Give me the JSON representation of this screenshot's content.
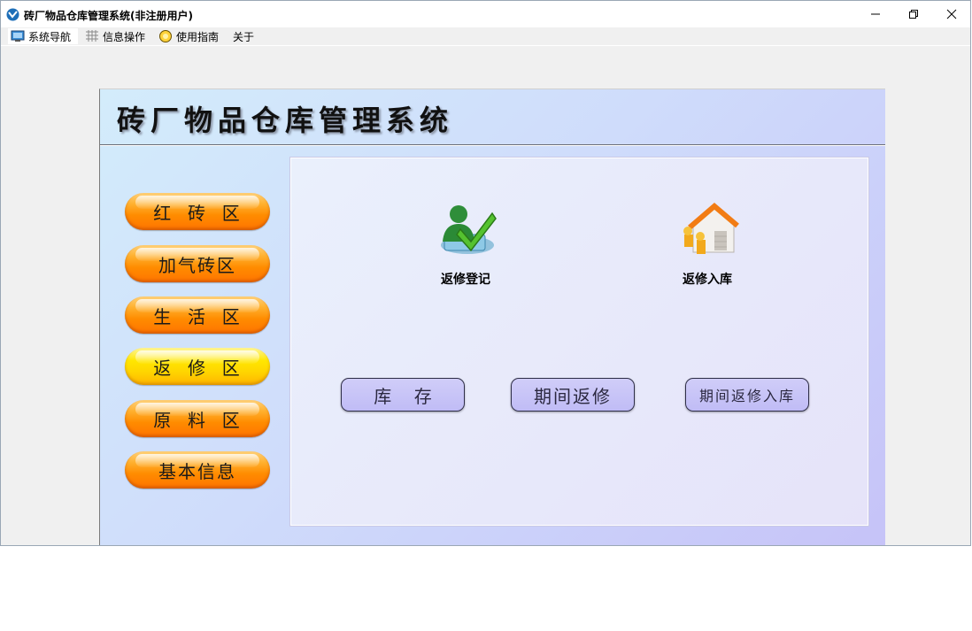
{
  "window": {
    "title": "砖厂物品仓库管理系统(非注册用户)"
  },
  "menu": [
    {
      "label": "系统导航",
      "icon": "monitor-icon",
      "active": true
    },
    {
      "label": "信息操作",
      "icon": "grid-icon",
      "active": false
    },
    {
      "label": "使用指南",
      "icon": "help-icon",
      "active": false
    },
    {
      "label": "关于",
      "icon": "",
      "active": false
    }
  ],
  "header": {
    "title": "砖厂物品仓库管理系统"
  },
  "nav": [
    {
      "label": "红  砖  区",
      "color": "#ff8c00"
    },
    {
      "label": "加气砖区",
      "color": "#ff8c00"
    },
    {
      "label": "生  活  区",
      "color": "#ff8c00"
    },
    {
      "label": "返  修  区",
      "color": "#ffd500"
    },
    {
      "label": "原  料  区",
      "color": "#ff8c00"
    },
    {
      "label": "基本信息",
      "color": "#ff8c00"
    }
  ],
  "content": {
    "icons": [
      {
        "label": "返修登记",
        "icon": "user-check-icon"
      },
      {
        "label": "返修入库",
        "icon": "warehouse-icon"
      }
    ],
    "buttons": [
      {
        "label": "库    存"
      },
      {
        "label": "期间返修"
      },
      {
        "label": "期间返修入库"
      }
    ]
  },
  "colors": {
    "accent_orange": "#ff8c00",
    "accent_yellow": "#ffd500",
    "button_lavender": "#c0bcf6"
  }
}
